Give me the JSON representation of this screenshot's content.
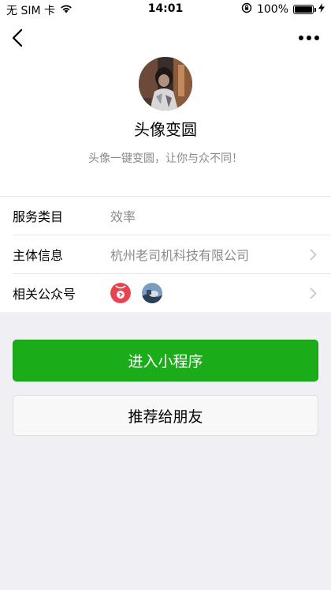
{
  "status_bar": {
    "carrier": "无 SIM 卡",
    "time": "14:01",
    "battery": "100%",
    "wifi_icon": "wifi-icon",
    "lock_icon": "orientation-lock-icon",
    "charging_icon": "charging-icon"
  },
  "nav": {
    "back_icon": "chevron-left-icon",
    "more_icon": "more-icon"
  },
  "app": {
    "name": "头像变圆",
    "description": "头像一键变圆，让你与众不同！"
  },
  "info": {
    "service_label": "服务类目",
    "service_value": "效率",
    "entity_label": "主体信息",
    "entity_value": "杭州老司机科技有限公司",
    "related_label": "相关公众号"
  },
  "actions": {
    "enter_label": "进入小程序",
    "share_label": "推荐给朋友"
  },
  "colors": {
    "primary_green": "#1aad19",
    "background": "#efeff4",
    "secondary_text": "#8a8a8a"
  }
}
